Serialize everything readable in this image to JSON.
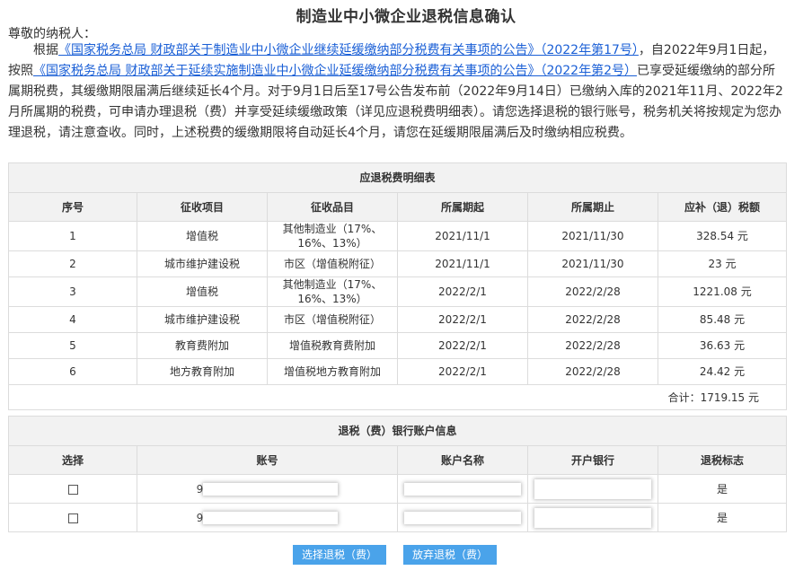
{
  "title": "制造业中小微企业退税信息确认",
  "greeting": "尊敬的纳税人：",
  "notice": {
    "p1": "根据",
    "link1": "《国家税务总局 财政部关于制造业中小微企业继续延缓缴纳部分税费有关事项的公告》（2022年第17号）",
    "p2": "，自2022年9月1日起，按照",
    "link2": "《国家税务总局 财政部关于延续实施制造业中小微企业延缓缴纳部分税费有关事项的公告》（2022年第2号）",
    "p3": "已享受延缓缴纳的部分所属期税费，其缓缴期限届满后继续延长4个月。对于9月1日后至17号公告发布前（2022年9月14日）已缴纳入库的2021年11月、2022年2月所属期的税费，可申请办理退税（费）并享受延续缓缴政策（详见应退税费明细表）。请您选择退税的银行账号，税务机关将按规定为您办理退税，请注意查收。同时，上述税费的缓缴期限将自动延长4个月，请您在延缓期限届满后及时缴纳相应税费。"
  },
  "tax_table": {
    "caption": "应退税费明细表",
    "headers": [
      "序号",
      "征收项目",
      "征收品目",
      "所属期起",
      "所属期止",
      "应补（退）税额"
    ],
    "rows": [
      [
        "1",
        "增值税",
        "其他制造业（17%、16%、13%）",
        "2021/11/1",
        "2021/11/30",
        "328.54 元"
      ],
      [
        "2",
        "城市维护建设税",
        "市区（增值税附征）",
        "2021/11/1",
        "2021/11/30",
        "23 元"
      ],
      [
        "3",
        "增值税",
        "其他制造业（17%、16%、13%）",
        "2022/2/1",
        "2022/2/28",
        "1221.08 元"
      ],
      [
        "4",
        "城市维护建设税",
        "市区（增值税附征）",
        "2022/2/1",
        "2022/2/28",
        "85.48 元"
      ],
      [
        "5",
        "教育费附加",
        "增值税教育费附加",
        "2022/2/1",
        "2022/2/28",
        "36.63 元"
      ],
      [
        "6",
        "地方教育附加",
        "增值税地方教育附加",
        "2022/2/1",
        "2022/2/28",
        "24.42 元"
      ]
    ],
    "total": "合计：1719.15 元"
  },
  "bank_table": {
    "caption": "退税（费）银行账户信息",
    "headers": [
      "选择",
      "账号",
      "账户名称",
      "开户银行",
      "退税标志"
    ],
    "rows": [
      {
        "account_prefix": "9",
        "flag": "是"
      },
      {
        "account_prefix": "9",
        "flag": "是"
      }
    ]
  },
  "buttons": {
    "select": "选择退税（费）",
    "abandon": "放弃退税（费）"
  },
  "colors": {
    "link": "#1a5fd6",
    "button": "#4aa3ea",
    "header_bg": "#f2f2f2"
  }
}
